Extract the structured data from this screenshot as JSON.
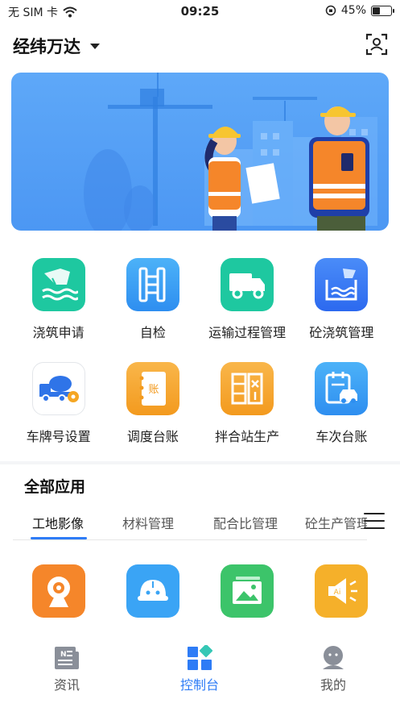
{
  "status_bar": {
    "carrier": "无 SIM 卡",
    "time": "09:25",
    "battery": "45%",
    "battery_level": 0.45
  },
  "header": {
    "company": "经纬万达"
  },
  "quick_apps": [
    {
      "label": "浇筑申请",
      "icon": "pouring-icon",
      "color": "#1ec8a0"
    },
    {
      "label": "自检",
      "icon": "checklist-icon",
      "color": "#3aa4f5"
    },
    {
      "label": "运输过程管理",
      "icon": "truck-icon",
      "color": "#1ec8a0"
    },
    {
      "label": "砼浇筑管理",
      "icon": "concrete-pour-icon",
      "color": "#3b7bf5"
    },
    {
      "label": "车牌号设置",
      "icon": "mixer-truck-icon",
      "color": "#ffffff"
    },
    {
      "label": "调度台账",
      "icon": "ledger-icon",
      "color": "#f5a623"
    },
    {
      "label": "拌合站生产",
      "icon": "mixing-station-icon",
      "color": "#f5a623"
    },
    {
      "label": "车次台账",
      "icon": "vehicle-trip-icon",
      "color": "#3aa4f5"
    }
  ],
  "all_apps": {
    "title": "全部应用",
    "tabs": [
      "工地影像",
      "材料管理",
      "配合比管理",
      "砼生产管理"
    ],
    "active_tab": 0,
    "icons": [
      {
        "icon": "camera-icon",
        "color": "#f5862a"
      },
      {
        "icon": "helmet-icon",
        "color": "#3aa4f5"
      },
      {
        "icon": "gallery-icon",
        "color": "#3cc46a"
      },
      {
        "icon": "ai-broadcast-icon",
        "color": "#f5b02a"
      }
    ]
  },
  "tabbar": {
    "items": [
      {
        "label": "资讯",
        "icon": "news-icon"
      },
      {
        "label": "控制台",
        "icon": "dashboard-icon"
      },
      {
        "label": "我的",
        "icon": "profile-icon"
      }
    ],
    "active": 1,
    "active_color": "#2e7cf6",
    "inactive_color": "#555555"
  }
}
